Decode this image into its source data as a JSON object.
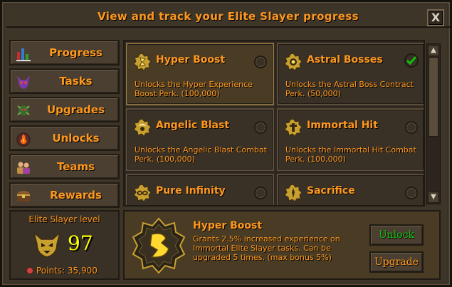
{
  "window": {
    "title": "View and track your Elite Slayer progress",
    "close_label": "X"
  },
  "sidebar": {
    "items": [
      {
        "label": "Progress",
        "icon": "bar-chart-icon"
      },
      {
        "label": "Tasks",
        "icon": "demon-head-icon"
      },
      {
        "label": "Upgrades",
        "icon": "creature-icon"
      },
      {
        "label": "Unlocks",
        "icon": "flame-orb-icon"
      },
      {
        "label": "Teams",
        "icon": "people-icon"
      },
      {
        "label": "Rewards",
        "icon": "chest-icon"
      }
    ]
  },
  "level": {
    "title": "Elite Slayer level",
    "value": "97",
    "points": "Points: 35,900"
  },
  "perks": [
    {
      "title": "Hyper Boost",
      "desc": "Unlocks the Hyper Experience Boost Perk. (100,000)",
      "state": "selected"
    },
    {
      "title": "Astral Bosses",
      "desc": "Unlocks the Astral Boss Contract Perk. (50,000)",
      "state": "unlocked"
    },
    {
      "title": "Angelic Blast",
      "desc": "Unlocks the Angelic Blast Combat Perk. (100,000)",
      "state": "locked"
    },
    {
      "title": "Immortal Hit",
      "desc": "Unlocks the Immortal Hit Combat Perk. (100,000)",
      "state": "locked"
    },
    {
      "title": "Pure Infinity",
      "desc": "",
      "state": "locked"
    },
    {
      "title": "Sacrifice",
      "desc": "",
      "state": "locked"
    }
  ],
  "detail": {
    "title": "Hyper Boost",
    "desc": "Grants 2.5% increased experience on Immortal Elite Slayer tasks. Can be upgraded 5 times. (max bonus 5%)",
    "unlock_label": "Unlock",
    "upgrade_label": "Upgrade"
  },
  "colors": {
    "text": "#ff981f",
    "unlock": "#0dc10d",
    "level": "#ffff00"
  }
}
